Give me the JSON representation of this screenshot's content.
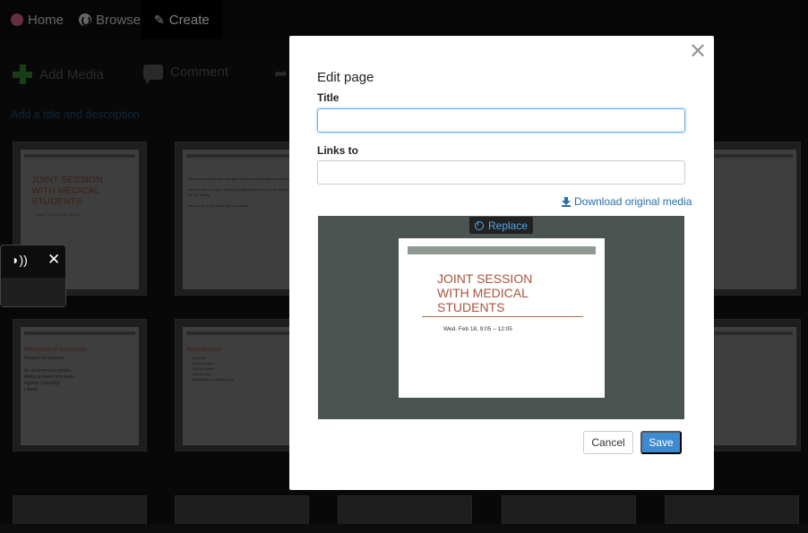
{
  "nav": {
    "home": "Home",
    "browse": "Browse",
    "create": "Create"
  },
  "toolbar": {
    "add_media": "Add Media",
    "comment": "Comment",
    "add_title": "Add a title and description"
  },
  "slides": [
    {
      "title": "JOINT SESSION\nWITH MEDICAL\nSTUDENTS",
      "text": "Wed. Feb 18, 9:05 – 12:05"
    },
    {
      "title": "",
      "text": "Check the course web site later this week (small group locations)\n\nSee Module 3: Cases, reading assignments and specific directions for the activity\n\nBe sure to do the readings in advance!"
    },
    {
      "title": "Elements of Autonomy",
      "text": "Respect for persons\n\nAn autonomous person:\nAbility to determine goals\nAgency (capacity)\nLiberty"
    },
    {
      "title": "Beneficence",
      "text": "Do good\nPrevent harm\nRemove harm\nDuty to help\nObligations of beneficence"
    }
  ],
  "modal": {
    "title": "Edit page",
    "title_label": "Title",
    "title_value": "",
    "links_label": "Links to",
    "links_value": "",
    "download_label": "Download original media",
    "replace_label": "Replace",
    "cancel_label": "Cancel",
    "save_label": "Save",
    "close_glyph": "✕"
  },
  "preview": {
    "title_line1": "JOINT SESSION",
    "title_line2": "WITH MEDICAL",
    "title_line3": "STUDENTS",
    "subtitle": "Wed. Feb 18, 9:05 – 12:05"
  },
  "colors": {
    "accent": "#3c8bd1",
    "link": "#2a6ea6",
    "add_green": "#2f7d2f",
    "slide_title": "#a8533a"
  }
}
